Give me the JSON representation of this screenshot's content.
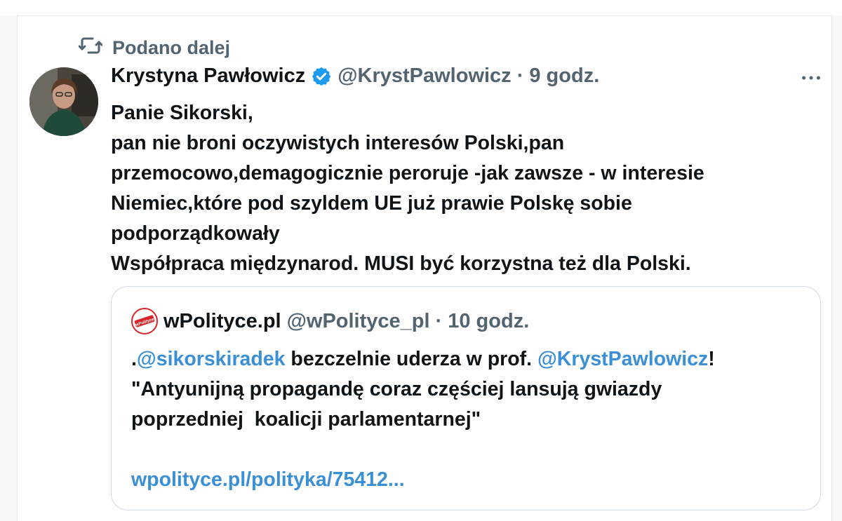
{
  "repost": {
    "icon": "repost-icon",
    "label": "Podano dalej"
  },
  "tweet": {
    "author_name": "Krystyna Pawłowicz",
    "handle": "@KrystPawlowicz",
    "separator": "·",
    "time": "9 godz.",
    "verified_icon": "verified-badge-icon",
    "more_icon": "more-options-icon",
    "lines": [
      "Panie Sikorski,",
      "pan nie broni oczywistych interesów Polski,pan",
      "przemocowo,demagogicznie peroruje -jak zawsze - w interesie",
      "Niemiec,które pod szyldem UE już prawie Polskę sobie",
      "podporządkowały",
      "Współpraca międzynarod. MUSI być korzystna też dla Polski."
    ]
  },
  "quote": {
    "avatar_icon": "wpolityce-logo-icon",
    "avatar_text": "wPolityce",
    "name": "wPolityce.pl",
    "handle": "@wPolityce_pl",
    "separator": "·",
    "time": "10 godz.",
    "line1_prefix": ".",
    "line1_mention1": "@sikorskiradek",
    "line1_middle": " bezczelnie uderza w prof. ",
    "line1_mention2": "@KrystPawlowicz",
    "line1_suffix": "!",
    "line2": "\"Antyunijną propagandę coraz częściej lansują gwiazdy",
    "line3": "poprzedniej  koalicji parlamentarnej\"",
    "link": "wpolityce.pl/polityka/75412..."
  },
  "colors": {
    "text": "#0f1419",
    "secondary": "#536471",
    "link": "#3a8fd6",
    "verified": "#1d9bf0",
    "brand_red": "#d9252a"
  }
}
